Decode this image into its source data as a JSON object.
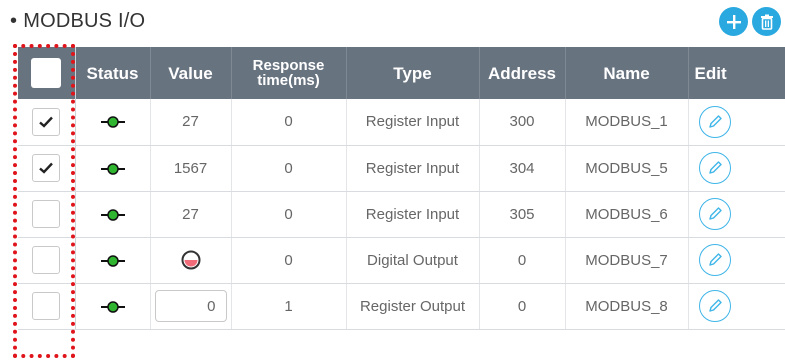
{
  "header": {
    "bullet": "•",
    "title": "MODBUS I/O",
    "add_button_icon": "plus-icon",
    "delete_button_icon": "trash-icon"
  },
  "table": {
    "columns": [
      {
        "key": "check",
        "label": ""
      },
      {
        "key": "status",
        "label": "Status"
      },
      {
        "key": "value",
        "label": "Value"
      },
      {
        "key": "response",
        "label_line1": "Response",
        "label_line2": "time(ms)"
      },
      {
        "key": "type",
        "label": "Type"
      },
      {
        "key": "address",
        "label": "Address"
      },
      {
        "key": "name",
        "label": "Name"
      },
      {
        "key": "edit",
        "label": "Edit"
      }
    ],
    "rows": [
      {
        "checked": true,
        "status": "connected",
        "value": "27",
        "response": "0",
        "type": "Register Input",
        "address": "300",
        "name": "MODBUS_1"
      },
      {
        "checked": true,
        "status": "connected",
        "value": "1567",
        "response": "0",
        "type": "Register Input",
        "address": "304",
        "name": "MODBUS_5"
      },
      {
        "checked": false,
        "status": "connected",
        "value": "27",
        "response": "0",
        "type": "Register Input",
        "address": "305",
        "name": "MODBUS_6"
      },
      {
        "checked": false,
        "status": "connected",
        "value_state": "off",
        "response": "0",
        "type": "Digital Output",
        "address": "0",
        "name": "MODBUS_7"
      },
      {
        "checked": false,
        "status": "connected",
        "value_input": "0",
        "response": "1",
        "type": "Register Output",
        "address": "0",
        "name": "MODBUS_8"
      }
    ]
  },
  "colors": {
    "header_bg": "#687380",
    "accent_blue": "#2aa9e0",
    "status_green": "#2fb52f",
    "off_red": "#f26b78",
    "selection_frame": "#e0151b"
  }
}
